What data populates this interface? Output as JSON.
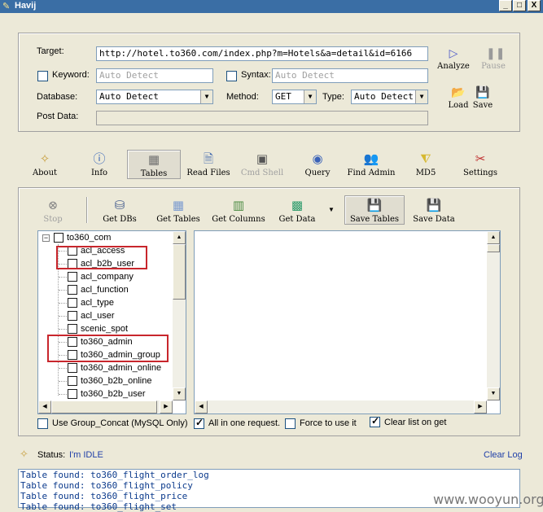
{
  "window": {
    "title": "Havij",
    "minimize": "_",
    "maximize": "□",
    "close": "X"
  },
  "form": {
    "target_label": "Target:",
    "target_value": "http://hotel.to360.com/index.php?m=Hotels&a=detail&id=6166",
    "keyword_label": "Keyword:",
    "keyword_value": "Auto Detect",
    "syntax_label": "Syntax:",
    "syntax_value": "Auto Detect",
    "database_label": "Database:",
    "database_value": "Auto Detect",
    "method_label": "Method:",
    "method_value": "GET",
    "type_label": "Type:",
    "type_value": "Auto Detect",
    "postdata_label": "Post Data:",
    "postdata_value": ""
  },
  "side_buttons": {
    "analyze": "Analyze",
    "pause": "Pause",
    "load": "Load",
    "save": "Save"
  },
  "tabs": [
    {
      "label": "About"
    },
    {
      "label": "Info"
    },
    {
      "label": "Tables"
    },
    {
      "label": "Read Files"
    },
    {
      "label": "Cmd Shell"
    },
    {
      "label": "Query"
    },
    {
      "label": "Find Admin"
    },
    {
      "label": "MD5"
    },
    {
      "label": "Settings"
    }
  ],
  "toolbar": {
    "stop": "Stop",
    "get_dbs": "Get DBs",
    "get_tables": "Get Tables",
    "get_columns": "Get Columns",
    "get_data": "Get Data",
    "save_tables": "Save Tables",
    "save_data": "Save Data"
  },
  "tree": {
    "root": "to360_com",
    "items": [
      "acl_access",
      "acl_b2b_user",
      "acl_company",
      "acl_function",
      "acl_type",
      "acl_user",
      "scenic_spot",
      "to360_admin",
      "to360_admin_group",
      "to360_admin_online",
      "to360_b2b_online",
      "to360_b2b_user"
    ]
  },
  "options": {
    "group_concat": "Use Group_Concat (MySQL Only)",
    "group_concat_checked": false,
    "all_in_one": "All in one request.",
    "all_in_one_checked": true,
    "force": "Force to use it",
    "force_checked": false,
    "clear_list": "Clear list on get",
    "clear_list_checked": true
  },
  "status": {
    "label": "Status:",
    "value": "I'm IDLE",
    "clear_log": "Clear Log"
  },
  "log": [
    "Table found: to360_flight_order_log",
    "Table found: to360_flight_policy",
    "Table found: to360_flight_price",
    "Table found: to360_flight_set"
  ],
  "watermark": "www.wooyun.org",
  "colors": {
    "titlebar": "#3a6ea5",
    "highlight_box": "#c8262c",
    "status_text": "#1f3fa8",
    "log_text": "#0b3a8c"
  }
}
